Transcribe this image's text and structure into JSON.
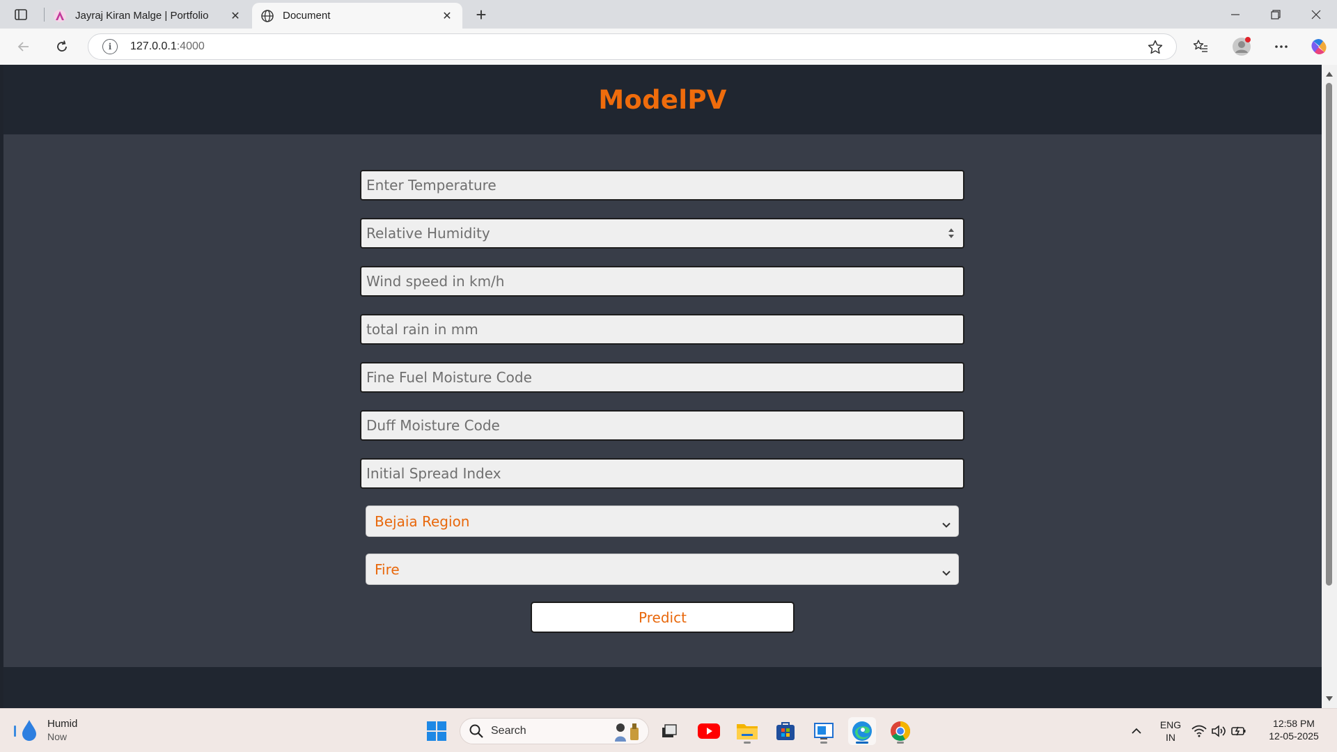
{
  "browser": {
    "tabs": [
      {
        "title": "Jayraj Kiran Malge | Portfolio",
        "active": false
      },
      {
        "title": "Document",
        "active": true
      }
    ],
    "url_host": "127.0.0.1",
    "url_port": ":4000"
  },
  "page": {
    "brand": "ModelPV",
    "fields": [
      {
        "placeholder": "Enter Temperature"
      },
      {
        "placeholder": "Relative Humidity"
      },
      {
        "placeholder": "Wind speed in km/h"
      },
      {
        "placeholder": "total rain in mm"
      },
      {
        "placeholder": "Fine Fuel Moisture Code"
      },
      {
        "placeholder": "Duff Moisture Code"
      },
      {
        "placeholder": "Initial Spread Index"
      }
    ],
    "region_select": "Bejaia Region",
    "class_select": "Fire",
    "predict_label": "Predict",
    "accent_color": "#e8680c"
  },
  "taskbar": {
    "weather_title": "Humid",
    "weather_sub": "Now",
    "search_placeholder": "Search",
    "lang_line1": "ENG",
    "lang_line2": "IN",
    "time": "12:58 PM",
    "date": "12-05-2025"
  }
}
